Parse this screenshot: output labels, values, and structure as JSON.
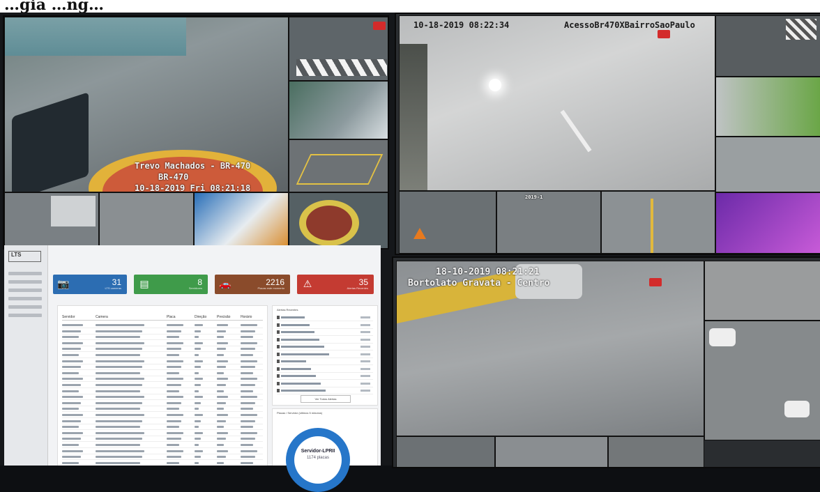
{
  "partial_heading": "…gia  …ng…",
  "cameras": {
    "a_main": {
      "lines": [
        "Trevo Machados - BR-470",
        "BR-470",
        "10-18-2019 Fri 08:21:18"
      ]
    },
    "b_main": {
      "timestamp": "10-18-2019 08:22:34",
      "name": "AcessoBr470XBairroSaoPaulo"
    },
    "b_small": {
      "timestamp": "2019-1"
    },
    "c_main": {
      "line1": "18-10-2019 08:21:21",
      "line2": "Bortolato Gravata - Centro"
    }
  },
  "dashboard": {
    "logo": "LTS",
    "cards": [
      {
        "icon": "📷",
        "value": "31",
        "caption": "LTS cameras",
        "color": "#2c6db2"
      },
      {
        "icon": "▤",
        "value": "8",
        "caption": "Servidores",
        "color": "#3f9b4a"
      },
      {
        "icon": "🚗",
        "value": "2216",
        "caption": "Placas este momento",
        "color": "#8a4b2b"
      },
      {
        "icon": "⚠",
        "value": "35",
        "caption": "Alertas Recentes",
        "color": "#c43b32"
      }
    ],
    "table": {
      "columns": [
        "Servidor",
        "Camera",
        "Placa",
        "Direção",
        "Precisão",
        "Horário"
      ],
      "row_count": 24
    },
    "alerts_title": "Alertas Recentes",
    "alerts_button": "Ver Todos Alertas",
    "servers_title": "Placas / Servidor (últimos 5 minutos)",
    "donut": {
      "label": "Servidor-LPRII",
      "value": "1174 placas",
      "color": "#2676c9"
    }
  }
}
